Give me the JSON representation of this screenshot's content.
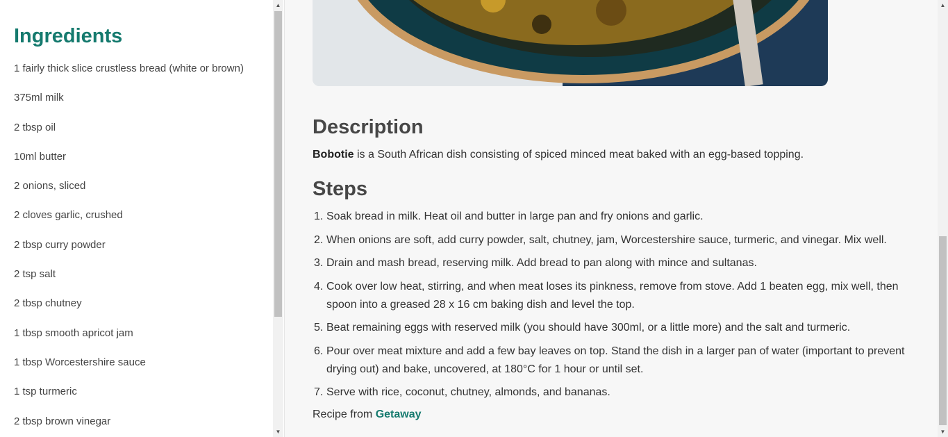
{
  "sidebar": {
    "heading": "Ingredients",
    "ingredients": [
      "1 fairly thick slice crustless bread (white or brown)",
      "375ml milk",
      "2 tbsp oil",
      "10ml butter",
      "2 onions, sliced",
      "2 cloves garlic, crushed",
      "2 tbsp curry powder",
      "2 tsp salt",
      "2 tbsp chutney",
      "1 tbsp smooth apricot jam",
      "1 tbsp Worcestershire sauce",
      "1 tsp turmeric",
      "2 tbsp brown vinegar"
    ]
  },
  "description": {
    "heading": "Description",
    "dish": "Bobotie",
    "text": " is a South African dish consisting of spiced minced meat baked with an egg-based topping."
  },
  "steps": {
    "heading": "Steps",
    "items": [
      {
        "num": "1.",
        "text": "Soak bread in milk. Heat oil and butter in large pan and fry onions and garlic."
      },
      {
        "num": "2.",
        "text": "When onions are soft, add curry powder, salt, chutney, jam, Worcestershire sauce, turmeric, and vinegar. Mix well."
      },
      {
        "num": "3.",
        "text": "Drain and mash bread, reserving milk. Add bread to pan along with mince and sultanas."
      },
      {
        "num": "4.",
        "text": "Cook over low heat, stirring, and when meat loses its pinkness, remove from stove. Add 1 beaten egg, mix well, then spoon into a greased 28 x 16 cm baking dish and level the top."
      },
      {
        "num": "5.",
        "text": "Beat remaining eggs with reserved milk (you should have 300ml, or a little more) and the salt and turmeric."
      },
      {
        "num": "6.",
        "text": "Pour over meat mixture and add a few bay leaves on top. Stand the dish in a larger pan of water (important to prevent drying out) and bake, uncovered, at 180°C for 1 hour or until set."
      },
      {
        "num": "7.",
        "text": "Serve with rice, coconut, chutney, almonds, and bananas."
      }
    ]
  },
  "source": {
    "prefix": "Recipe from ",
    "link_label": "Getaway"
  },
  "colors": {
    "accent": "#157a6e",
    "heading": "#474747",
    "background": "#f7f7f7"
  }
}
